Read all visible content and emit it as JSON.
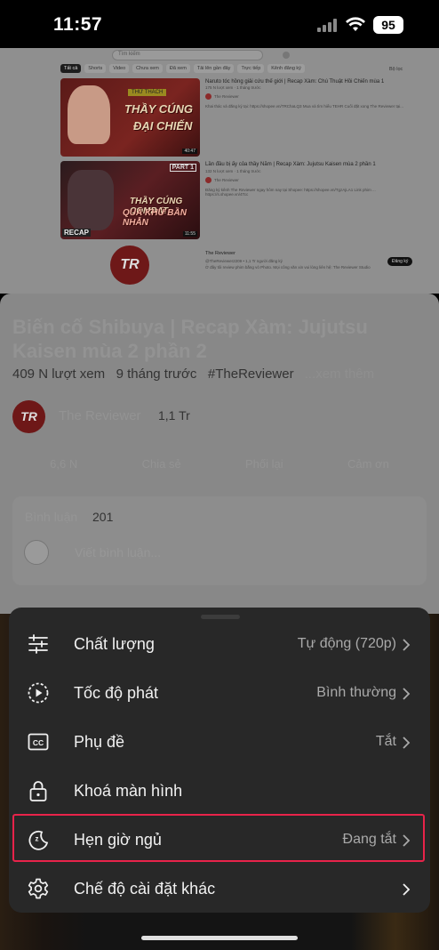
{
  "status_bar": {
    "time": "11:57",
    "battery": "95"
  },
  "video_frame": {
    "search_placeholder": "Tìm kiếm",
    "chips": [
      "Tất cả",
      "Shorts",
      "Video",
      "Chưa xem",
      "Đã xem",
      "Tải lên gần đây",
      "Trực tiếp",
      "Kênh đăng ký"
    ],
    "filter_label": "Bộ lọc",
    "results": [
      {
        "thumb_tag": "THỬ THÁCH",
        "thumb_line1": "THẦY CÚNG",
        "thumb_line2": "ĐẠI CHIẾN",
        "duration": "40:47",
        "title": "Naruto tóc hồng giải cứu thế giới | Recap Xàm: Chú Thuật Hồi Chiến mùa 1",
        "meta": "175 N lượt xem · 1 tháng trước",
        "channel": "The Reviewer",
        "desc": "Khai thác và đăng ký tại: https://shopee.vn/TRChaLQ3 Mua và tìm hiểu TEHR Cuối đặt xong The Reviewer tại..."
      },
      {
        "thumb_part": "PART 1",
        "thumb_line1": "THẦY CÚNG COMBAT",
        "thumb_line2": "QUÁ KHỨ BẦN NHẪN",
        "thumb_recap": "RECAP",
        "duration": "11:55",
        "title": "Lần đầu bị ấy của thầy Năm | Recap Xàm: Jujutsu Kaisen mùa 2 phần 1",
        "meta": "132 N lượt xem · 1 tháng trước",
        "channel": "The Reviewer",
        "desc": "Đăng ký kênh The Reviewer ngay hôm nay tại Shopee: https://shopee.vn/TgzAjLA1 Link phim ... https://s.shopee.vn/4Tcc"
      }
    ],
    "channel_card": {
      "logo": "TR",
      "name": "The Reviewer",
      "sub": "@TheReviewer2209 • 1,1 Tr người đăng ký",
      "desc": "Ở đây tôi review phim bằng vỏ Photo. Mọi công văn xin vui lòng liên hệ: The Reviewer Studio",
      "button": "Đăng ký"
    }
  },
  "watch_page": {
    "title": "Biến cố Shibuya | Recap Xàm: Jujutsu Kaisen mùa 2 phần 2",
    "views": "409 N lượt xem",
    "age": "9 tháng trước",
    "hashtag": "#TheReviewer",
    "more": "...xem thêm",
    "channel_logo": "TR",
    "channel_name": "The Reviewer",
    "subscribers": "1,1 Tr",
    "actions": [
      "6,6 N",
      "Chia sẻ",
      "Phối lại",
      "Cảm ơn"
    ],
    "comments_label": "Bình luận",
    "comments_count": "201",
    "comment_placeholder": "Viết bình luận..."
  },
  "settings_sheet": {
    "items": [
      {
        "label": "Chất lượng",
        "value": "Tự động (720p)",
        "icon": "sliders-icon"
      },
      {
        "label": "Tốc độ phát",
        "value": "Bình thường",
        "icon": "playback-speed-icon"
      },
      {
        "label": "Phụ đề",
        "value": "Tắt",
        "icon": "captions-icon"
      },
      {
        "label": "Khoá màn hình",
        "value": "",
        "icon": "lock-icon"
      },
      {
        "label": "Hẹn giờ ngủ",
        "value": "Đang tắt",
        "icon": "sleep-timer-icon",
        "highlighted": true
      },
      {
        "label": "Chế độ cài đặt khác",
        "value": "",
        "icon": "gear-icon"
      }
    ]
  },
  "colors": {
    "sheet_bg": "#282828",
    "highlight_border": "#e8234a",
    "text_primary": "#f1f1f1",
    "text_secondary": "#aaaaaa"
  }
}
